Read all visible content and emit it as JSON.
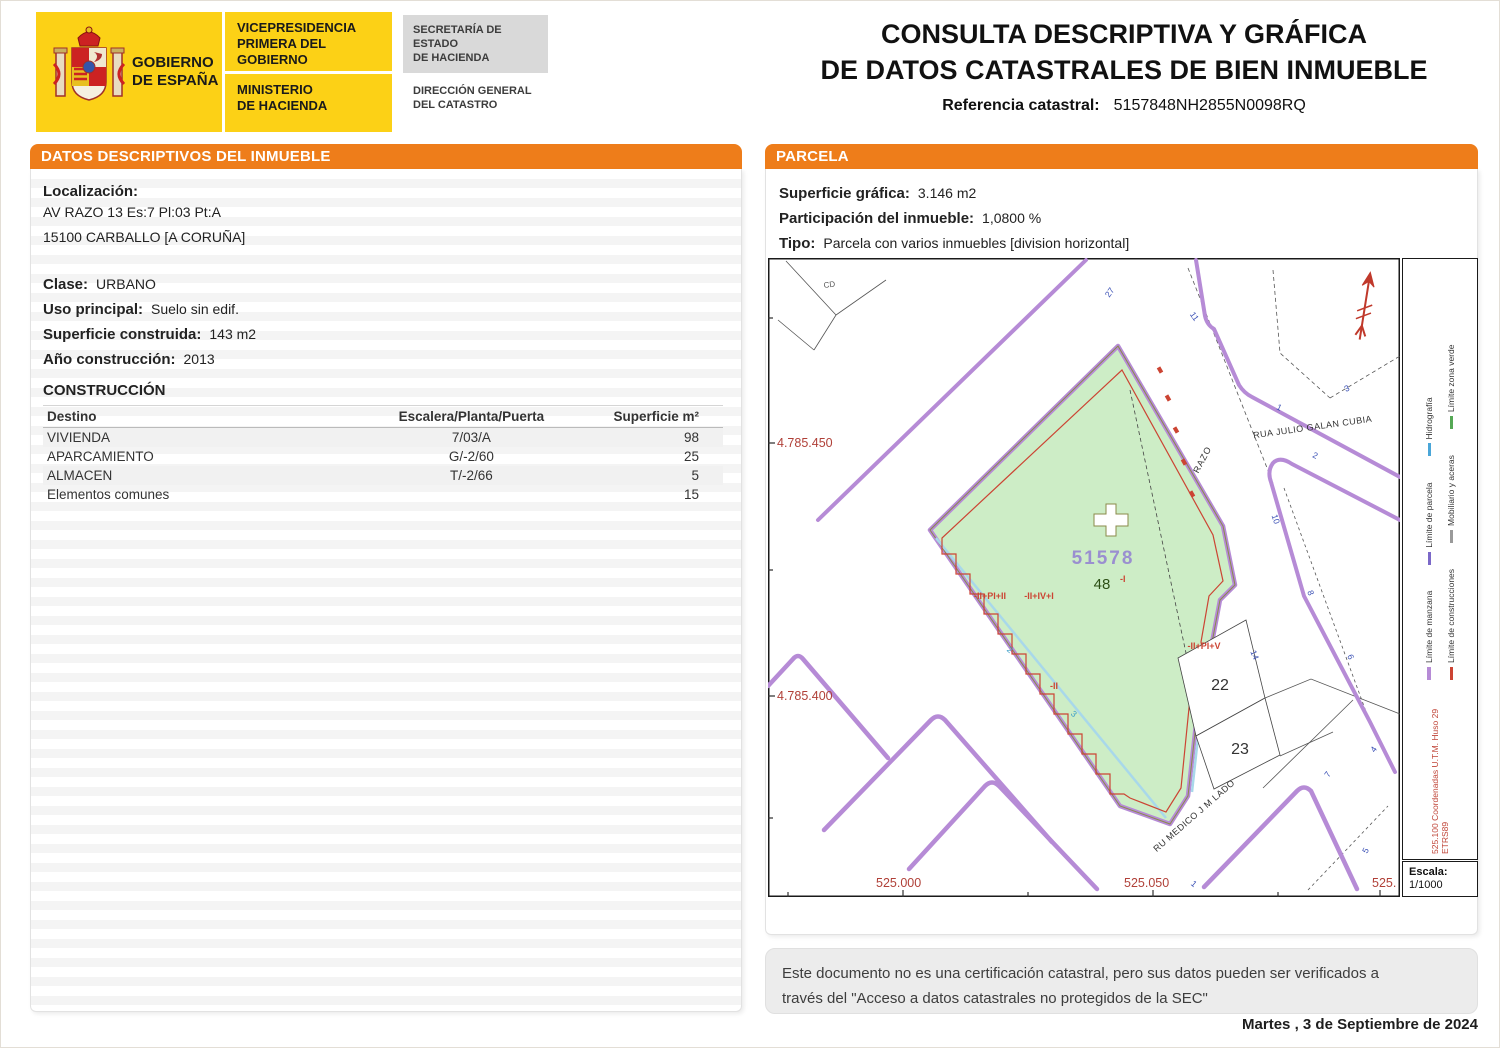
{
  "colors": {
    "accent_orange": "#EE7D1A",
    "header_yellow": "#FCD116",
    "map_green": "#CDEDC6",
    "street_purple": "#B68BD6",
    "construction_red": "#CC4433",
    "coord_red": "#B04038",
    "parcel_label_purple": "#9A8FD0"
  },
  "header": {
    "gobierno_line1": "GOBIERNO",
    "gobierno_line2": "DE ESPAÑA",
    "vice_line1": "VICEPRESIDENCIA",
    "vice_line2": "PRIMERA DEL GOBIERNO",
    "min_line1": "MINISTERIO",
    "min_line2": "DE HACIENDA",
    "sec_line1": "SECRETARÍA DE ESTADO",
    "sec_line2": "DE HACIENDA",
    "dir_line1": "DIRECCIÓN GENERAL",
    "dir_line2": "DEL CATASTRO",
    "title_line1": "CONSULTA DESCRIPTIVA Y GRÁFICA",
    "title_line2": "DE DATOS CATASTRALES DE BIEN INMUEBLE",
    "ref_label": "Referencia catastral:",
    "ref_value": "5157848NH2855N0098RQ"
  },
  "left_panel": {
    "header": "DATOS DESCRIPTIVOS DEL INMUEBLE",
    "localizacion_label": "Localización:",
    "address_line1": "AV RAZO 13 Es:7 Pl:03 Pt:A",
    "address_line2": "15100 CARBALLO [A CORUÑA]",
    "fields": [
      {
        "label": "Clase:",
        "value": "URBANO"
      },
      {
        "label": "Uso principal:",
        "value": "Suelo sin edif."
      },
      {
        "label": "Superficie construida:",
        "value": "143 m2"
      },
      {
        "label": "Año construcción:",
        "value": "2013"
      }
    ],
    "construccion_title": "CONSTRUCCIÓN",
    "table": {
      "headers": [
        "Destino",
        "Escalera/Planta/Puerta",
        "Superficie m²"
      ],
      "rows": [
        {
          "destino": "VIVIENDA",
          "escalera": "7/03/A",
          "superficie": "98"
        },
        {
          "destino": "APARCAMIENTO",
          "escalera": "G/-2/60",
          "superficie": "25"
        },
        {
          "destino": "ALMACEN",
          "escalera": "T/-2/66",
          "superficie": "5"
        },
        {
          "destino": "Elementos comunes",
          "escalera": "",
          "superficie": "15"
        }
      ]
    }
  },
  "parcela_panel": {
    "header": "PARCELA",
    "fields": [
      {
        "label": "Superficie gráfica:",
        "value": "3.146 m2"
      },
      {
        "label": "Participación del inmueble:",
        "value": "1,0800 %"
      },
      {
        "label": "Tipo:",
        "value": "Parcela con varios inmuebles [division horizontal]"
      }
    ]
  },
  "map": {
    "parcel_label": "51578",
    "plot_number": "48",
    "plot_storeys": "-I",
    "coords": {
      "left_top": "4.785.450",
      "left_bottom": "4.785.400",
      "bottom_left": "525.000",
      "bottom_mid": "525.050",
      "bottom_right": "525."
    },
    "streets": {
      "razo": "RAZO",
      "julio": "RUA JULIO GALAN CUBIA",
      "medico": "RU MEDICO J M LADO"
    },
    "labels": {
      "cd": "CD",
      "c1": "-II+PI+II",
      "c2": "-II+IV+I",
      "c3": "-II+PI+V",
      "c4": "-II"
    },
    "parcels": {
      "p22": "22",
      "p23": "23"
    },
    "numbers": {
      "n27": "27",
      "n11": "11",
      "n3": "3",
      "n1": "1",
      "n2": "2",
      "n10": "10",
      "n8": "8",
      "n6": "6",
      "n14": "14",
      "n7": "7",
      "n4": "4",
      "n5": "5",
      "n2b": "2",
      "n3b": "3",
      "n1b": "1"
    }
  },
  "legend": {
    "row1": [
      {
        "label": "Límite de manzana",
        "color": "#B68BD6"
      },
      {
        "label": "Límite de parcela",
        "color": "#7B68C8"
      },
      {
        "label": "Hidrografía",
        "color": "#4AA6D8"
      }
    ],
    "row2": [
      {
        "label": "Límite de construcciones",
        "color": "#CC4433"
      },
      {
        "label": "Mobiliario y aceras",
        "color": "#9A9A9A"
      },
      {
        "label": "Límite zona verde",
        "color": "#55A855"
      }
    ],
    "coords_note": "525.100 Coordenadas U.T.M. Huso 29 ETRS89",
    "escala_label": "Escala:",
    "escala_value": "1/1000"
  },
  "footer": {
    "disclaimer_line1": "Este documento no es una certificación catastral, pero sus datos pueden ser verificados a",
    "disclaimer_line2": "través del \"Acceso a datos catastrales no protegidos de la SEC\"",
    "date": "Martes , 3 de Septiembre de 2024"
  }
}
